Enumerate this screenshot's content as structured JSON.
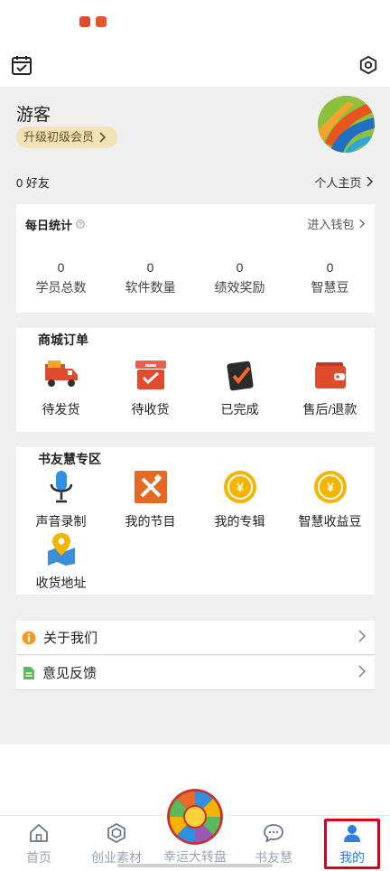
{
  "profile": {
    "name": "游客",
    "member_badge": "升级初级会员",
    "friends": "0 好友",
    "homepage_link": "个人主页"
  },
  "daily_stats": {
    "title": "每日统计",
    "wallet_link": "进入钱包",
    "items": [
      {
        "value": "0",
        "label": "学员总数"
      },
      {
        "value": "0",
        "label": "软件数量"
      },
      {
        "value": "0",
        "label": "绩效奖励"
      },
      {
        "value": "0",
        "label": "智慧豆"
      }
    ]
  },
  "orders": {
    "title": "商城订单",
    "items": [
      {
        "label": "待发货",
        "icon": "delivery-truck-icon"
      },
      {
        "label": "待收货",
        "icon": "inbox-check-icon"
      },
      {
        "label": "已完成",
        "icon": "completed-clipboard-icon"
      },
      {
        "label": "售后/退款",
        "icon": "wallet-icon"
      }
    ]
  },
  "zone": {
    "title": "书友慧专区",
    "items": [
      {
        "label": "声音录制",
        "icon": "microphone-icon"
      },
      {
        "label": "我的节目",
        "icon": "pencil-ruler-icon"
      },
      {
        "label": "我的专辑",
        "icon": "yen-coin-icon"
      },
      {
        "label": "智慧收益豆",
        "icon": "yen-coin-icon"
      },
      {
        "label": "收货地址",
        "icon": "map-pin-icon"
      }
    ]
  },
  "list": {
    "about": "关于我们",
    "feedback": "意见反馈"
  },
  "tabs": [
    {
      "label": "首页",
      "icon": "home-icon"
    },
    {
      "label": "创业素材",
      "icon": "cube-icon"
    },
    {
      "label": "幸运大转盘",
      "icon": "lucky-wheel-icon"
    },
    {
      "label": "书友慧",
      "icon": "chat-bubble-icon"
    },
    {
      "label": "我的",
      "icon": "user-icon"
    }
  ],
  "wheel_text": "幸运大转盘",
  "colors": {
    "accent_blue": "#2f7de1",
    "badge_bg": "#f2e2b8",
    "order_red": "#e04a2f",
    "coin_yellow": "#f5b400",
    "highlight_red": "#d9001b"
  }
}
